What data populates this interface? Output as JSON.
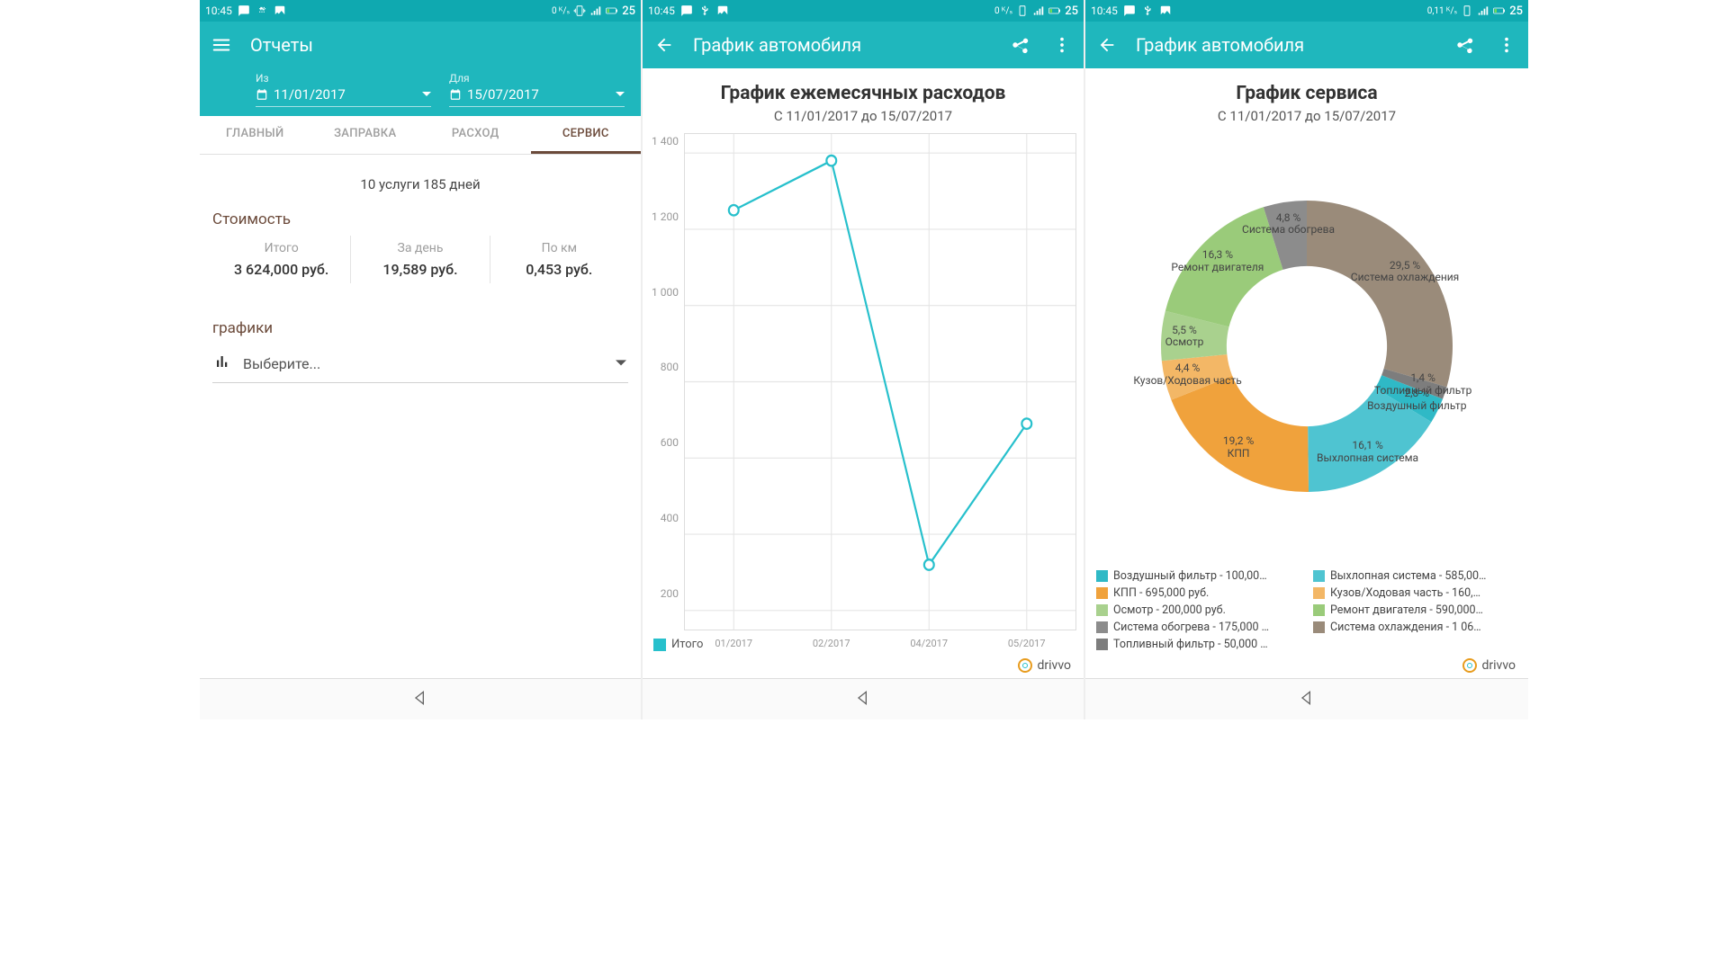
{
  "status": {
    "time": "10:45",
    "kbs_zero": "0 ᴷ/ₛ",
    "kbs_nonzero": "0,11 ᴷ/ₛ",
    "battery": "25"
  },
  "screen1": {
    "title": "Отчеты",
    "from_lbl": "Из",
    "to_lbl": "Для",
    "date_from": "11/01/2017",
    "date_to": "15/07/2017",
    "tabs": {
      "t0": "ГЛАВНЫЙ",
      "t1": "ЗАПРАВКА",
      "t2": "РАСХОД",
      "t3": "СЕРВИС"
    },
    "summary": "10 услуги 185 дней",
    "cost_title": "Стоимость",
    "cost": {
      "c0h": "Итого",
      "c0v": "3 624,000 руб.",
      "c1h": "За день",
      "c1v": "19,589 руб.",
      "c2h": "По км",
      "c2v": "0,453 руб."
    },
    "charts_title": "графики",
    "select_placeholder": "Выберите..."
  },
  "screen2": {
    "appbar_title": "График автомобиля",
    "chart_title": "График ежемесячных расходов",
    "chart_sub": "С 11/01/2017 до 15/07/2017",
    "legend": "Итого",
    "brand": "drivvo"
  },
  "screen3": {
    "appbar_title": "График автомобиля",
    "chart_title": "График сервиса",
    "chart_sub": "С 11/01/2017 до 15/07/2017",
    "brand": "drivvo",
    "legend": {
      "i0": "Воздушный фильтр - 100,00…",
      "i1": "Выхлопная система - 585,00…",
      "i2": "КПП - 695,000 руб.",
      "i3": "Кузов/Ходовая часть - 160,…",
      "i4": "Осмотр - 200,000 руб.",
      "i5": "Ремонт двигателя - 590,000…",
      "i6": "Система обогрева - 175,000 …",
      "i7": "Система охлаждения - 1 06…",
      "i8": "Топливный фильтр - 50,000 …"
    }
  },
  "chart_data": [
    {
      "type": "line",
      "title": "График ежемесячных расходов",
      "subtitle": "С 11/01/2017 до 15/07/2017",
      "x": [
        "01/2017",
        "02/2017",
        "04/2017",
        "05/2017"
      ],
      "xticks": [
        "01/2017",
        "02/2017",
        "04/2017",
        "05/2017"
      ],
      "series": [
        {
          "name": "Итого",
          "values": [
            1250,
            1380,
            320,
            690
          ]
        }
      ],
      "yticks": [
        200,
        400,
        600,
        800,
        1000,
        1200,
        1400
      ],
      "ylim": [
        150,
        1450
      ],
      "xlabel": "",
      "ylabel": ""
    },
    {
      "type": "pie",
      "title": "График сервиса",
      "subtitle": "С 11/01/2017 до 15/07/2017",
      "hole": 0.55,
      "series": [
        {
          "name": "Система охлаждения",
          "value": 29.5,
          "color": "#9a8b7a"
        },
        {
          "name": "Топливный фильтр",
          "value": 1.4,
          "color": "#7d7d7d"
        },
        {
          "name": "Воздушный фильтр",
          "value": 2.8,
          "color": "#2fb9c6"
        },
        {
          "name": "Выхлопная система",
          "value": 16.1,
          "color": "#4fc4d1"
        },
        {
          "name": "КПП",
          "value": 19.2,
          "color": "#f0a23c"
        },
        {
          "name": "Кузов/Ходовая часть",
          "value": 4.4,
          "color": "#f3b766"
        },
        {
          "name": "Осмотр",
          "value": 5.5,
          "color": "#a9d18e"
        },
        {
          "name": "Ремонт двигателя",
          "value": 16.3,
          "color": "#9acb7a"
        },
        {
          "name": "Система обогрева",
          "value": 4.8,
          "color": "#8c8c8c"
        }
      ],
      "labels_on_chart": [
        {
          "txt": "29,5 %\nСистема охлаждения"
        },
        {
          "txt": "1,4 %\nТопливный фильтр"
        },
        {
          "txt": "2,8 %\nВоздушный фильтр"
        },
        {
          "txt": "16,1 %\nВыхлопная система"
        },
        {
          "txt": "19,2 %\nКПП"
        },
        {
          "txt": "4,4 %\nКузов/Ходовая часть"
        },
        {
          "txt": "5,5 %\nОсмотр"
        },
        {
          "txt": "16,3 %\nРемонт двигателя"
        },
        {
          "txt": "4,8 %\nСистема обогрева"
        }
      ]
    }
  ]
}
